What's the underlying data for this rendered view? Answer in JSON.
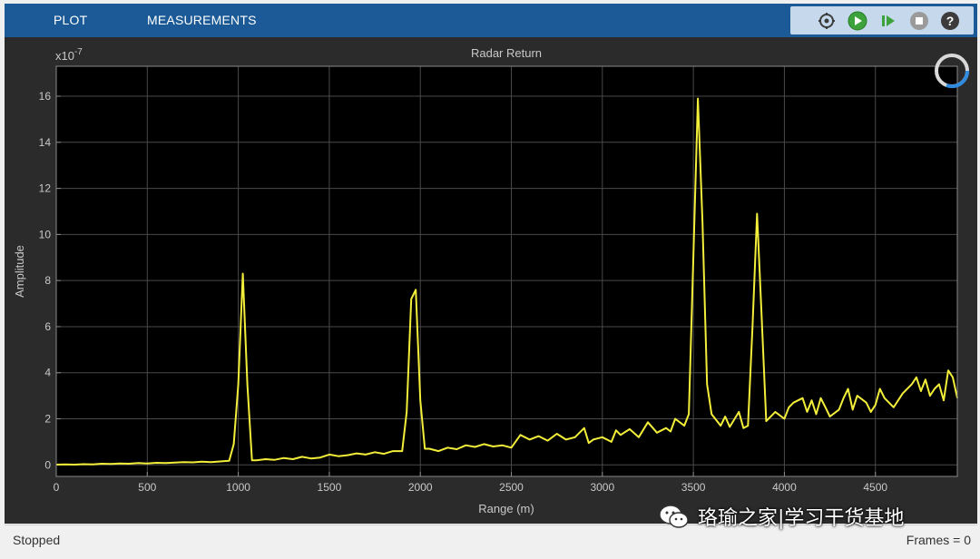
{
  "toolstrip": {
    "tabs": [
      {
        "label": "PLOT"
      },
      {
        "label": "MEASUREMENTS"
      }
    ],
    "quick_access": [
      "settings-icon",
      "run-icon",
      "step-forward-icon",
      "stop-icon",
      "help-icon"
    ]
  },
  "status": {
    "state": "Stopped",
    "frames": "Frames = 0"
  },
  "watermark": {
    "text": "珞瑜之家|学习干货基地"
  },
  "colors": {
    "toolstrip": "#1b5a96",
    "axes_bg": "#000000",
    "figure_bg": "#2b2b2b",
    "trace": "#f2ee3a",
    "grid": "#4a4a4a",
    "tick_text": "#c9c9c9"
  },
  "chart_data": {
    "type": "line",
    "title": "Radar Return",
    "xlabel": "Range (m)",
    "ylabel": "Amplitude",
    "y_exponent_label": "x10",
    "y_exponent": "-7",
    "xlim": [
      0,
      4950
    ],
    "ylim": [
      -0.5,
      17.3
    ],
    "grid": true,
    "xticks": [
      0,
      500,
      1000,
      1500,
      2000,
      2500,
      3000,
      3500,
      4000,
      4500
    ],
    "yticks": [
      0,
      2,
      4,
      6,
      8,
      10,
      12,
      14,
      16
    ],
    "series": [
      {
        "x": [
          0,
          50,
          100,
          150,
          200,
          250,
          300,
          350,
          400,
          450,
          500,
          550,
          600,
          650,
          700,
          750,
          800,
          850,
          900,
          950,
          975,
          1000,
          1025,
          1050,
          1075,
          1100,
          1150,
          1200,
          1250,
          1300,
          1350,
          1400,
          1450,
          1500,
          1550,
          1600,
          1650,
          1700,
          1750,
          1800,
          1850,
          1900,
          1925,
          1950,
          1975,
          2000,
          2025,
          2050,
          2100,
          2150,
          2200,
          2250,
          2300,
          2350,
          2400,
          2450,
          2500,
          2550,
          2600,
          2650,
          2700,
          2750,
          2800,
          2850,
          2900,
          2925,
          2950,
          3000,
          3050,
          3075,
          3100,
          3150,
          3200,
          3250,
          3300,
          3350,
          3375,
          3400,
          3450,
          3475,
          3500,
          3525,
          3550,
          3575,
          3600,
          3650,
          3675,
          3700,
          3750,
          3775,
          3800,
          3825,
          3850,
          3875,
          3900,
          3950,
          4000,
          4025,
          4050,
          4100,
          4125,
          4150,
          4175,
          4200,
          4225,
          4250,
          4300,
          4325,
          4350,
          4375,
          4400,
          4450,
          4475,
          4500,
          4525,
          4550,
          4600,
          4650,
          4700,
          4725,
          4750,
          4775,
          4800,
          4825,
          4850,
          4875,
          4900,
          4925,
          4950
        ],
        "y": [
          0.01,
          0.02,
          0.01,
          0.03,
          0.02,
          0.05,
          0.04,
          0.06,
          0.05,
          0.08,
          0.06,
          0.09,
          0.08,
          0.1,
          0.12,
          0.11,
          0.14,
          0.12,
          0.15,
          0.18,
          0.9,
          3.5,
          8.3,
          3.5,
          0.2,
          0.2,
          0.25,
          0.22,
          0.3,
          0.25,
          0.35,
          0.28,
          0.32,
          0.45,
          0.38,
          0.42,
          0.5,
          0.45,
          0.55,
          0.48,
          0.6,
          0.6,
          2.3,
          7.2,
          7.6,
          2.8,
          0.7,
          0.7,
          0.6,
          0.75,
          0.68,
          0.85,
          0.78,
          0.9,
          0.8,
          0.85,
          0.75,
          1.3,
          1.1,
          1.25,
          1.05,
          1.35,
          1.1,
          1.2,
          1.6,
          0.95,
          1.1,
          1.2,
          1.0,
          1.5,
          1.3,
          1.55,
          1.2,
          1.85,
          1.4,
          1.6,
          1.45,
          2.0,
          1.7,
          2.2,
          9.0,
          15.9,
          10.5,
          3.5,
          2.2,
          1.7,
          2.1,
          1.65,
          2.3,
          1.6,
          1.7,
          6.0,
          10.9,
          6.5,
          1.9,
          2.3,
          2.0,
          2.5,
          2.7,
          2.9,
          2.3,
          2.8,
          2.2,
          2.9,
          2.5,
          2.1,
          2.4,
          2.9,
          3.3,
          2.4,
          3.0,
          2.7,
          2.3,
          2.6,
          3.3,
          2.9,
          2.5,
          3.1,
          3.5,
          3.8,
          3.2,
          3.7,
          3.0,
          3.3,
          3.5,
          2.8,
          4.1,
          3.8,
          2.9
        ]
      }
    ]
  }
}
